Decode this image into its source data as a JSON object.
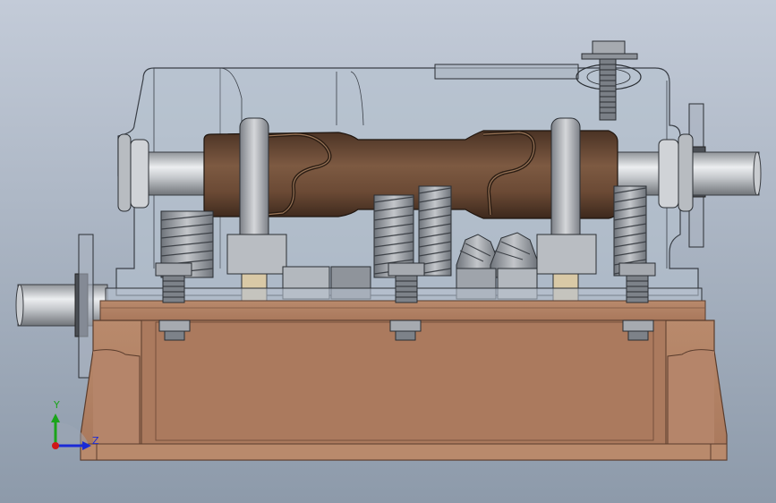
{
  "viewport": {
    "background_top": "#c3cbd8",
    "background_bottom": "#8d9aaa"
  },
  "triad": {
    "y_label": "Y",
    "z_label": "Z",
    "y_color": "#1aa41a",
    "z_color": "#1a2ad6",
    "origin_color": "#d01818"
  },
  "colors": {
    "housing_copper": "#a9785c",
    "housing_dark": "#7a5440",
    "shaft_steel": "#b9bcc0",
    "cam_brown": "#6b4a35",
    "gear_steel": "#8e939a",
    "bolt_steel": "#9ca0a6",
    "glass": "#b7c2cf"
  },
  "icons": {
    "triad": "coordinate-axes-icon"
  }
}
